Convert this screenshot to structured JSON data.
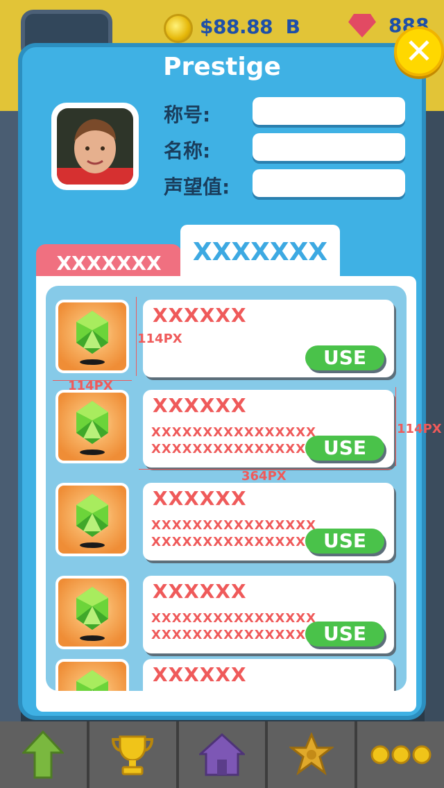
{
  "hud": {
    "money": "$88.88",
    "money_suffix": "B",
    "gem_count": "888"
  },
  "modal": {
    "title": "Prestige",
    "fields": [
      {
        "label": "称号:",
        "value": ""
      },
      {
        "label": "名称:",
        "value": ""
      },
      {
        "label": "声望值:",
        "value": ""
      }
    ],
    "tabs": [
      {
        "label": "XXXXXXX",
        "active": false
      },
      {
        "label": "XXXXXXX",
        "active": true
      }
    ]
  },
  "items": [
    {
      "name": "XXXXXX",
      "desc1": "",
      "desc2": "",
      "use": "USE"
    },
    {
      "name": "XXXXXX",
      "desc1": "XXXXXXXXXXXXXXXX",
      "desc2": "XXXXXXXXXXXXXXXX",
      "use": "USE"
    },
    {
      "name": "XXXXXX",
      "desc1": "XXXXXXXXXXXXXXXX",
      "desc2": "XXXXXXXXXXXXXXXX",
      "use": "USE"
    },
    {
      "name": "XXXXXX",
      "desc1": "XXXXXXXXXXXXXXXX",
      "desc2": "XXXXXXXXXXXXXXXX",
      "use": "USE"
    },
    {
      "name": "XXXXXX",
      "desc1": "",
      "desc2": "",
      "use": ""
    }
  ],
  "annotations": {
    "icon_height": "114PX",
    "icon_width": "114PX",
    "card_height": "114PX",
    "card_width": "364PX"
  },
  "bottom_nav": [
    "up-arrow-icon",
    "trophy-icon",
    "home-icon",
    "sheriff-star-icon",
    "more-dots-icon"
  ],
  "colors": {
    "modal_blue": "#3fb1e4",
    "accent_red": "#ef5a5a",
    "use_green": "#4ac24a",
    "tab_pink": "#f07080",
    "close_yellow": "#ffd800"
  }
}
